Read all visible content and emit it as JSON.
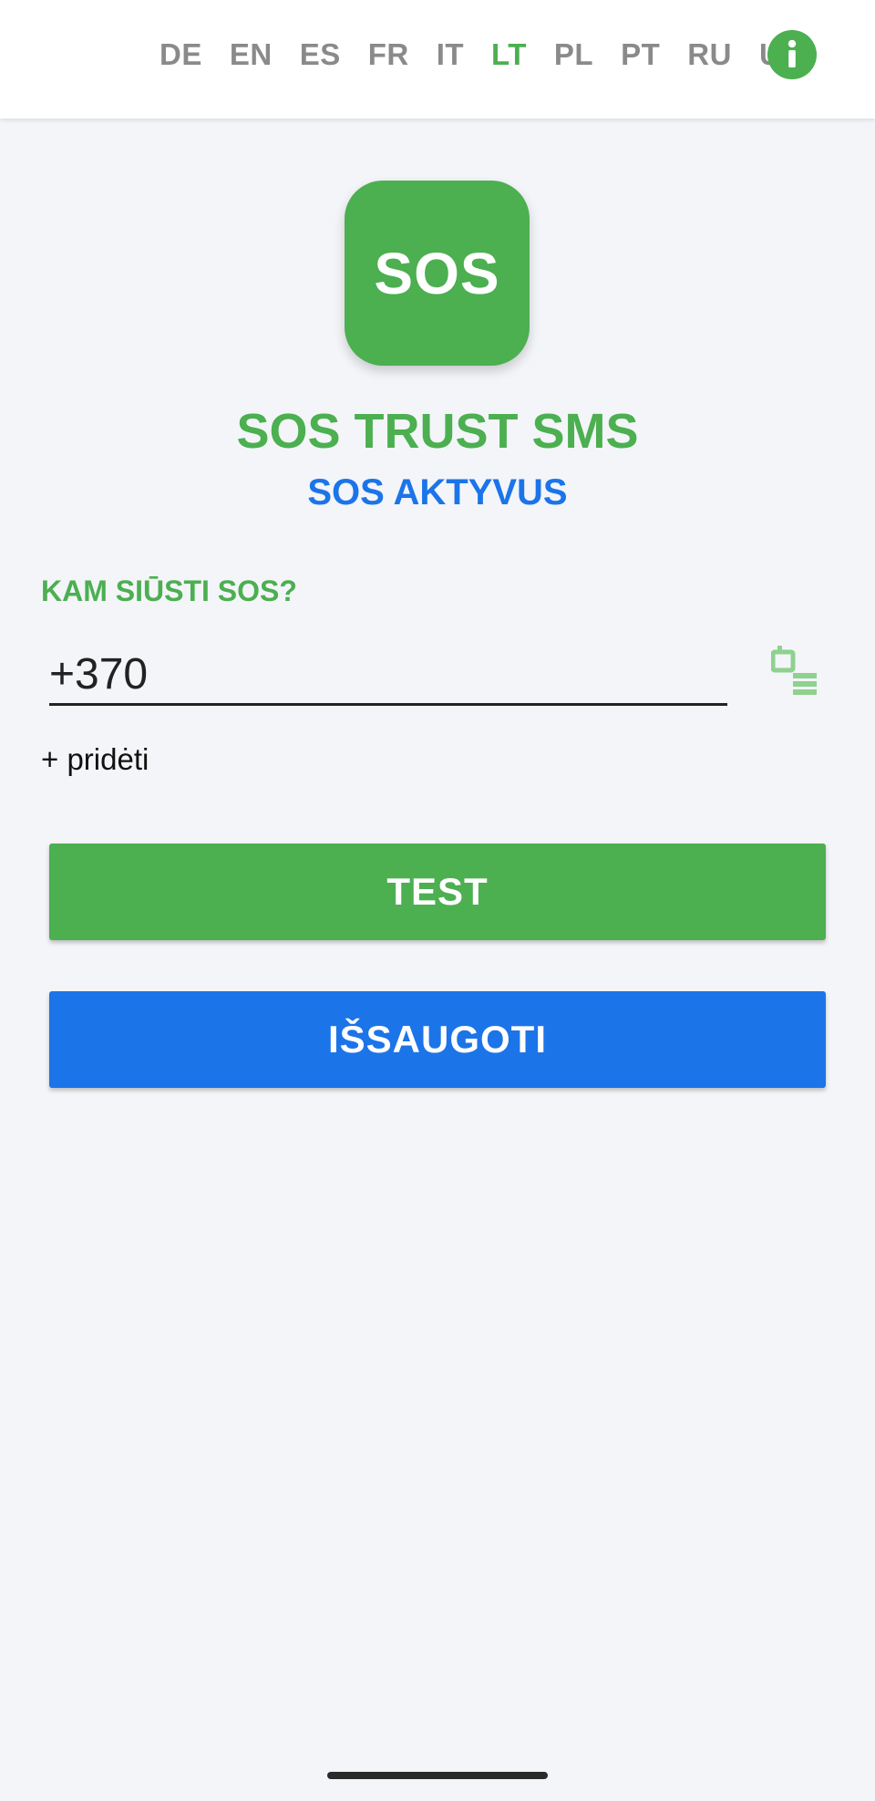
{
  "languages": [
    {
      "code": "DE",
      "active": false
    },
    {
      "code": "EN",
      "active": false
    },
    {
      "code": "ES",
      "active": false
    },
    {
      "code": "FR",
      "active": false
    },
    {
      "code": "IT",
      "active": false
    },
    {
      "code": "LT",
      "active": true
    },
    {
      "code": "PL",
      "active": false
    },
    {
      "code": "PT",
      "active": false
    },
    {
      "code": "RU",
      "active": false
    },
    {
      "code": "UK",
      "active": false
    }
  ],
  "header": {
    "info_icon": "info-icon"
  },
  "logo": {
    "text": "SOS"
  },
  "app": {
    "title": "SOS TRUST SMS",
    "status": "SOS AKTYVUS"
  },
  "form": {
    "send_label": "KAM SIŪSTI SOS?",
    "phone_value": "+370",
    "contacts_icon": "contacts-list-icon",
    "add_label": "+ pridėti"
  },
  "buttons": {
    "test": "TEST",
    "save": "IŠSAUGOTI"
  },
  "colors": {
    "accent_green": "#4caf50",
    "accent_blue": "#1c74e9",
    "inactive_lang": "#8a8a8a",
    "background": "#f3f5f9"
  }
}
